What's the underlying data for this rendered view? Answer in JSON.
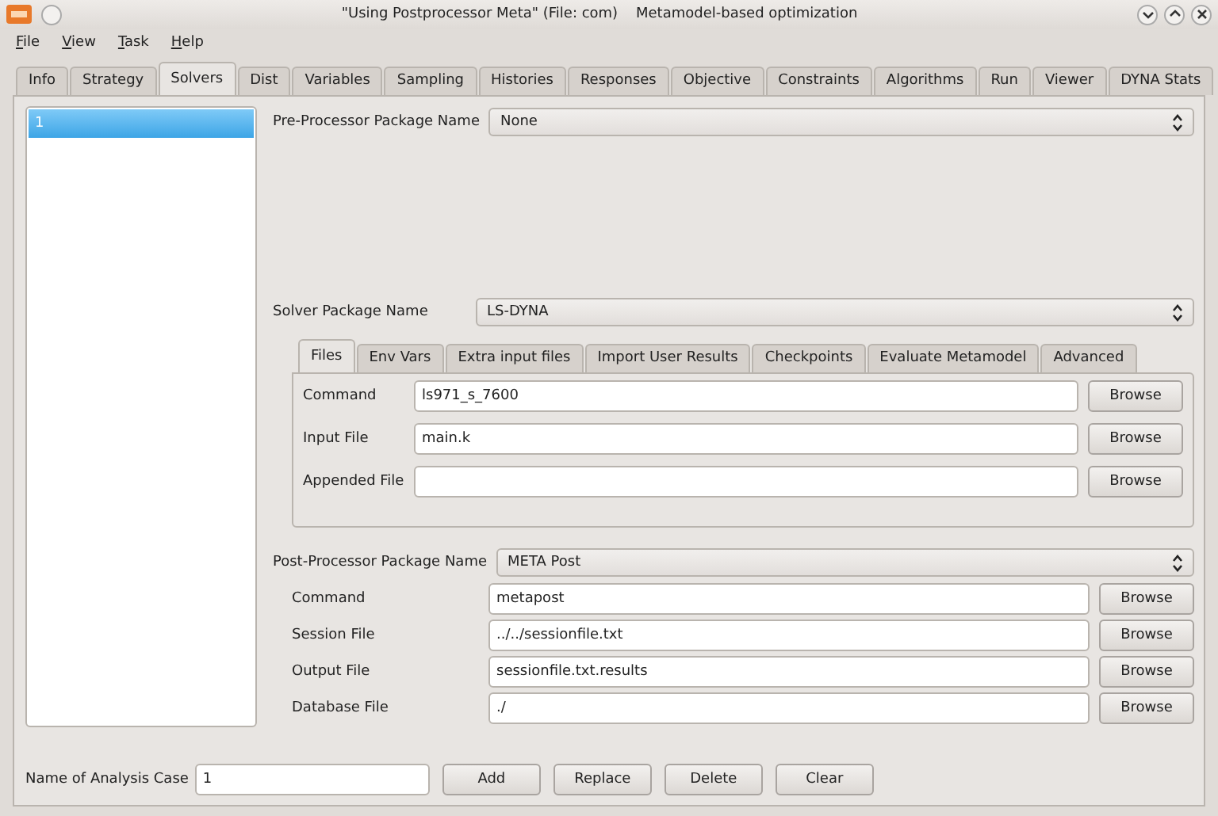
{
  "window": {
    "title": "\"Using Postprocessor Meta\" (File: com)    Metamodel-based optimization"
  },
  "menu": [
    "File",
    "View",
    "Task",
    "Help"
  ],
  "tabs": [
    {
      "label": "Info",
      "selected": false
    },
    {
      "label": "Strategy",
      "selected": false
    },
    {
      "label": "Solvers",
      "selected": true
    },
    {
      "label": "Dist",
      "selected": false
    },
    {
      "label": "Variables",
      "selected": false
    },
    {
      "label": "Sampling",
      "selected": false
    },
    {
      "label": "Histories",
      "selected": false
    },
    {
      "label": "Responses",
      "selected": false
    },
    {
      "label": "Objective",
      "selected": false
    },
    {
      "label": "Constraints",
      "selected": false
    },
    {
      "label": "Algorithms",
      "selected": false
    },
    {
      "label": "Run",
      "selected": false
    },
    {
      "label": "Viewer",
      "selected": false
    },
    {
      "label": "DYNA Stats",
      "selected": false
    }
  ],
  "cases": [
    {
      "label": "1",
      "selected": true
    }
  ],
  "pre_processor": {
    "label": "Pre-Processor Package Name",
    "value": "None"
  },
  "solver": {
    "label": "Solver Package Name",
    "value": "LS-DYNA"
  },
  "solver_tabs": [
    {
      "label": "Files",
      "selected": true
    },
    {
      "label": "Env Vars",
      "selected": false
    },
    {
      "label": "Extra input files",
      "selected": false
    },
    {
      "label": "Import User Results",
      "selected": false
    },
    {
      "label": "Checkpoints",
      "selected": false
    },
    {
      "label": "Evaluate Metamodel",
      "selected": false
    },
    {
      "label": "Advanced",
      "selected": false
    }
  ],
  "solver_files": [
    {
      "label": "Command",
      "value": "ls971_s_7600",
      "button": "Browse"
    },
    {
      "label": "Input File",
      "value": "main.k",
      "button": "Browse"
    },
    {
      "label": "Appended File",
      "button": "Browse"
    }
  ],
  "post_processor": {
    "label": "Post-Processor Package Name",
    "value": "META Post"
  },
  "post_files": [
    {
      "label": "Command",
      "value": "metapost",
      "button": "Browse"
    },
    {
      "label": "Session File",
      "value": "../../sessionfile.txt",
      "button": "Browse"
    },
    {
      "label": "Output File",
      "value": "sessionfile.txt.results",
      "button": "Browse"
    },
    {
      "label": "Database File",
      "value": "./",
      "button": "Browse"
    }
  ],
  "analysis_case": {
    "label": "Name of Analysis Case",
    "value": "1"
  },
  "buttons": [
    "Add",
    "Replace",
    "Delete",
    "Clear"
  ]
}
